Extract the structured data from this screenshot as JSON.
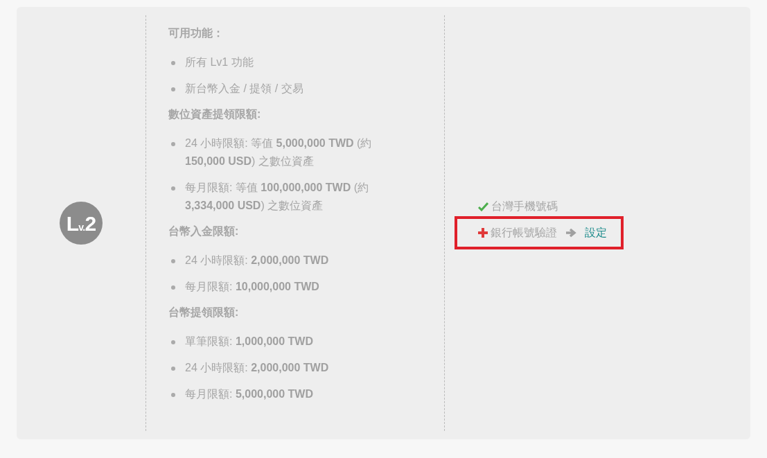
{
  "level_badge": "L$_{v.}$2",
  "sections": [
    {
      "heading": "可用功能：",
      "items": [
        "所有 Lv1 功能",
        "新台幣入金 / 提領 / 交易"
      ]
    },
    {
      "heading": "數位資產提領限額:",
      "items": [
        "24 小時限額: 等值 **5,000,000 TWD** (約 **150,000 USD**) 之數位資產",
        "每月限額: 等值 **100,000,000 TWD** (約 **3,334,000 USD**) 之數位資產"
      ]
    },
    {
      "heading": "台幣入金限額:",
      "items": [
        "24 小時限額: **2,000,000 TWD**",
        "每月限額: **10,000,000 TWD**"
      ]
    },
    {
      "heading": "台幣提領限額:",
      "items": [
        "單筆限額: **1,000,000 TWD**",
        "24 小時限額: **2,000,000 TWD**",
        "每月限額: **5,000,000 TWD**"
      ]
    }
  ],
  "requirements": [
    {
      "label": "台灣手機號碼",
      "kind": "done",
      "highlighted": false
    },
    {
      "label": "銀行帳號驗證",
      "kind": "todo",
      "highlighted": true,
      "action": "設定"
    }
  ]
}
